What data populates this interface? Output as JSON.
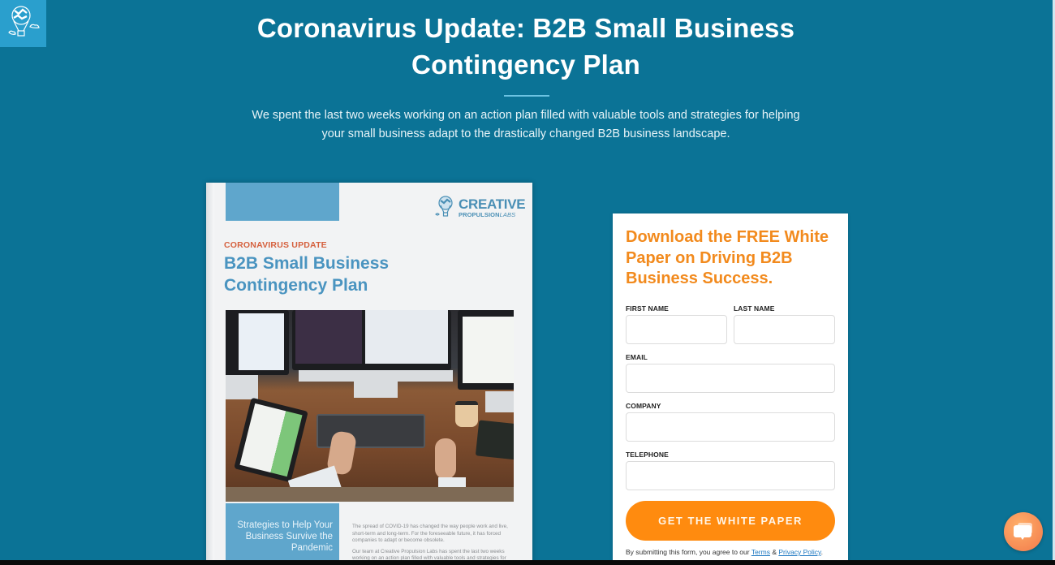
{
  "header": {
    "logo_icon": "hot-air-balloon-icon",
    "title": "Coronavirus Update: B2B Small Business Contingency Plan",
    "subtitle": "We spent the last two weeks working on an action plan filled with valuable tools and strategies for helping your small business adapt to the drastically changed B2B business landscape."
  },
  "brochure": {
    "brand_name": "CREATIVE",
    "brand_sub_1": "PROPULSION",
    "brand_sub_2": "LABS",
    "kicker": "CORONAVIRUS UPDATE",
    "title": "B2B Small Business Contingency Plan",
    "photo_alt": "Desk with monitors, keyboard, tablet and hands typing",
    "panel_text": "Strategies to Help Your Business Survive the Pandemic",
    "body_p1": "The spread of COVID-19 has changed the way people work and live, short-term and long-term. For the foreseeable future, it has forced companies to adapt or become obsolete.",
    "body_p2": "Our team at Creative Propulsion Labs has spent the last two weeks working on an action plan filled with valuable tools and strategies for"
  },
  "form": {
    "title": "Download the FREE White Paper on Driving B2B Business Success.",
    "fields": {
      "first_name": {
        "label": "FIRST NAME",
        "value": "",
        "placeholder": ""
      },
      "last_name": {
        "label": "LAST NAME",
        "value": "",
        "placeholder": ""
      },
      "email": {
        "label": "EMAIL",
        "value": "",
        "placeholder": ""
      },
      "company": {
        "label": "COMPANY",
        "value": "",
        "placeholder": ""
      },
      "telephone": {
        "label": "TELEPHONE",
        "value": "",
        "placeholder": ""
      }
    },
    "submit_label": "GET THE WHITE PAPER",
    "legal_prefix": "By submitting this form, you agree to our ",
    "terms_link": "Terms",
    "legal_and": " & ",
    "privacy_link": "Privacy Policy",
    "legal_suffix": "."
  },
  "chat": {
    "icon": "chat-bubble-icon"
  },
  "colors": {
    "background": "#0b7396",
    "logo_box": "#2a9fcd",
    "accent_orange": "#ff8b0f",
    "form_title_orange": "#f28a1d",
    "brochure_blue": "#4a94c0",
    "brochure_kicker": "#d5603d",
    "link_blue": "#1d78c1"
  }
}
